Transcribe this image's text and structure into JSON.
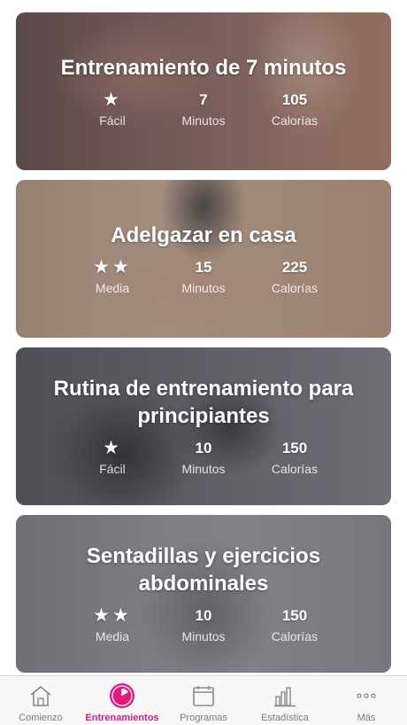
{
  "workouts": [
    {
      "title": "Entrenamiento de 7 minutos",
      "difficulty_icon": "★",
      "difficulty": "Fácil",
      "minutes": "7",
      "minutes_label": "Minutos",
      "calories": "105",
      "calories_label": "Calorías"
    },
    {
      "title": "Adelgazar en casa",
      "difficulty_icon": "★★",
      "difficulty": "Media",
      "minutes": "15",
      "minutes_label": "Minutos",
      "calories": "225",
      "calories_label": "Calorías"
    },
    {
      "title": "Rutina de entrenamiento para principiantes",
      "difficulty_icon": "★",
      "difficulty": "Fácil",
      "minutes": "10",
      "minutes_label": "Minutos",
      "calories": "150",
      "calories_label": "Calorías"
    },
    {
      "title": "Sentadillas y ejercicios abdominales",
      "difficulty_icon": "★★",
      "difficulty": "Media",
      "minutes": "10",
      "minutes_label": "Minutos",
      "calories": "150",
      "calories_label": "Calorías"
    }
  ],
  "tabbar": {
    "active_color": "#e5197c",
    "inactive_color": "#7a7a7a",
    "tabs": [
      {
        "label": "Comienzo",
        "icon": "home-icon"
      },
      {
        "label": "Entrenamientos",
        "icon": "stopwatch-icon",
        "active": true
      },
      {
        "label": "Programas",
        "icon": "calendar-icon"
      },
      {
        "label": "Estadística",
        "icon": "bar-chart-icon"
      },
      {
        "label": "Más",
        "icon": "more-dots-icon"
      }
    ]
  }
}
